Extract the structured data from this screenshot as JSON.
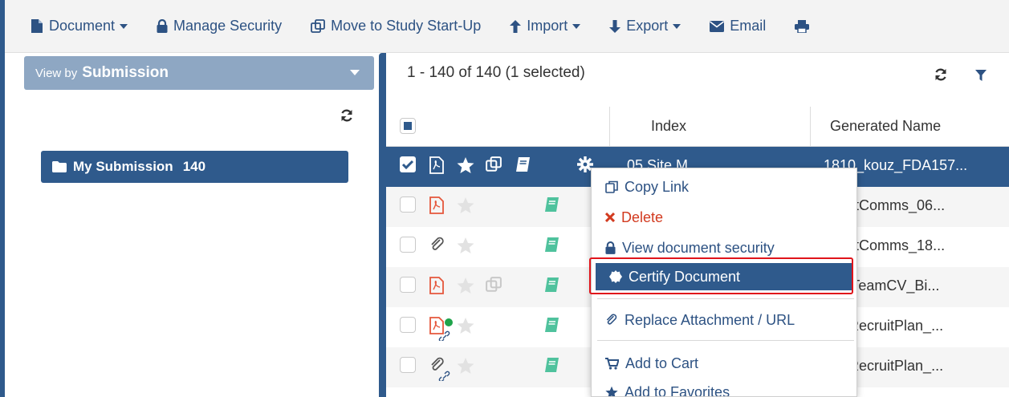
{
  "toolbar": {
    "document": "Document",
    "manage_security": "Manage Security",
    "move_to_study": "Move to Study Start-Up",
    "import": "Import",
    "export": "Export",
    "email": "Email"
  },
  "left": {
    "view_by_prefix": "View by",
    "view_by_value": "Submission",
    "folder_label": "My Submission",
    "folder_count": "140"
  },
  "grid": {
    "count_text": "1 - 140 of 140 (1 selected)",
    "col_index": "Index",
    "col_generated_name": "Generated Name",
    "rows": [
      {
        "index": "05 Site M",
        "generated_name": "1810_kouz_FDA157..."
      },
      {
        "index": "",
        "generated_name": "evantComms_06..."
      },
      {
        "index": "",
        "generated_name": "evantComms_18..."
      },
      {
        "index": "",
        "generated_name": "TrialTeamCV_Bi..."
      },
      {
        "index": "",
        "generated_name": "ter_RecruitPlan_..."
      },
      {
        "index": "",
        "generated_name": "ter_RecruitPlan_..."
      }
    ]
  },
  "context_menu": {
    "copy_link": "Copy Link",
    "delete": "Delete",
    "view_security": "View document security",
    "certify": "Certify Document",
    "replace": "Replace Attachment / URL",
    "add_cart": "Add to Cart",
    "add_favorites": "Add to Favorites"
  },
  "colors": {
    "primary": "#2f5a8c",
    "danger": "#d23a1f",
    "highlight_outline": "#e0141b",
    "pdf_icon": "#e5573c",
    "book_icon": "#4fc29d",
    "status_dot": "#1fa34a"
  }
}
